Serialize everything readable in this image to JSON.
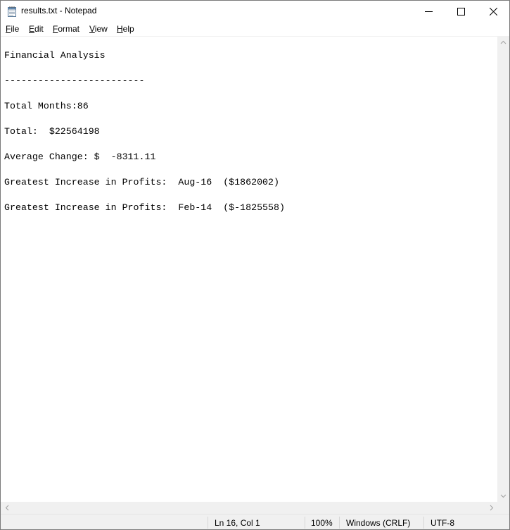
{
  "window": {
    "title": "results.txt - Notepad",
    "icon": "notepad-icon"
  },
  "menu": [
    {
      "label": "File",
      "access": "F",
      "rest": "ile"
    },
    {
      "label": "Edit",
      "access": "E",
      "rest": "dit"
    },
    {
      "label": "Format",
      "access": "F",
      "rest": "ormat",
      "pre": ""
    },
    {
      "label": "View",
      "access": "V",
      "rest": "iew"
    },
    {
      "label": "Help",
      "access": "H",
      "rest": "elp"
    }
  ],
  "document": {
    "lines": [
      "Financial Analysis",
      "-------------------------",
      "Total Months:86",
      "Total:  $22564198",
      "Average Change: $  -8311.11",
      "Greatest Increase in Profits:  Aug-16  ($1862002)",
      "Greatest Increase in Profits:  Feb-14  ($-1825558)"
    ]
  },
  "status": {
    "position": "Ln 16, Col 1",
    "zoom": "100%",
    "line_ending": "Windows (CRLF)",
    "encoding": "UTF-8"
  }
}
